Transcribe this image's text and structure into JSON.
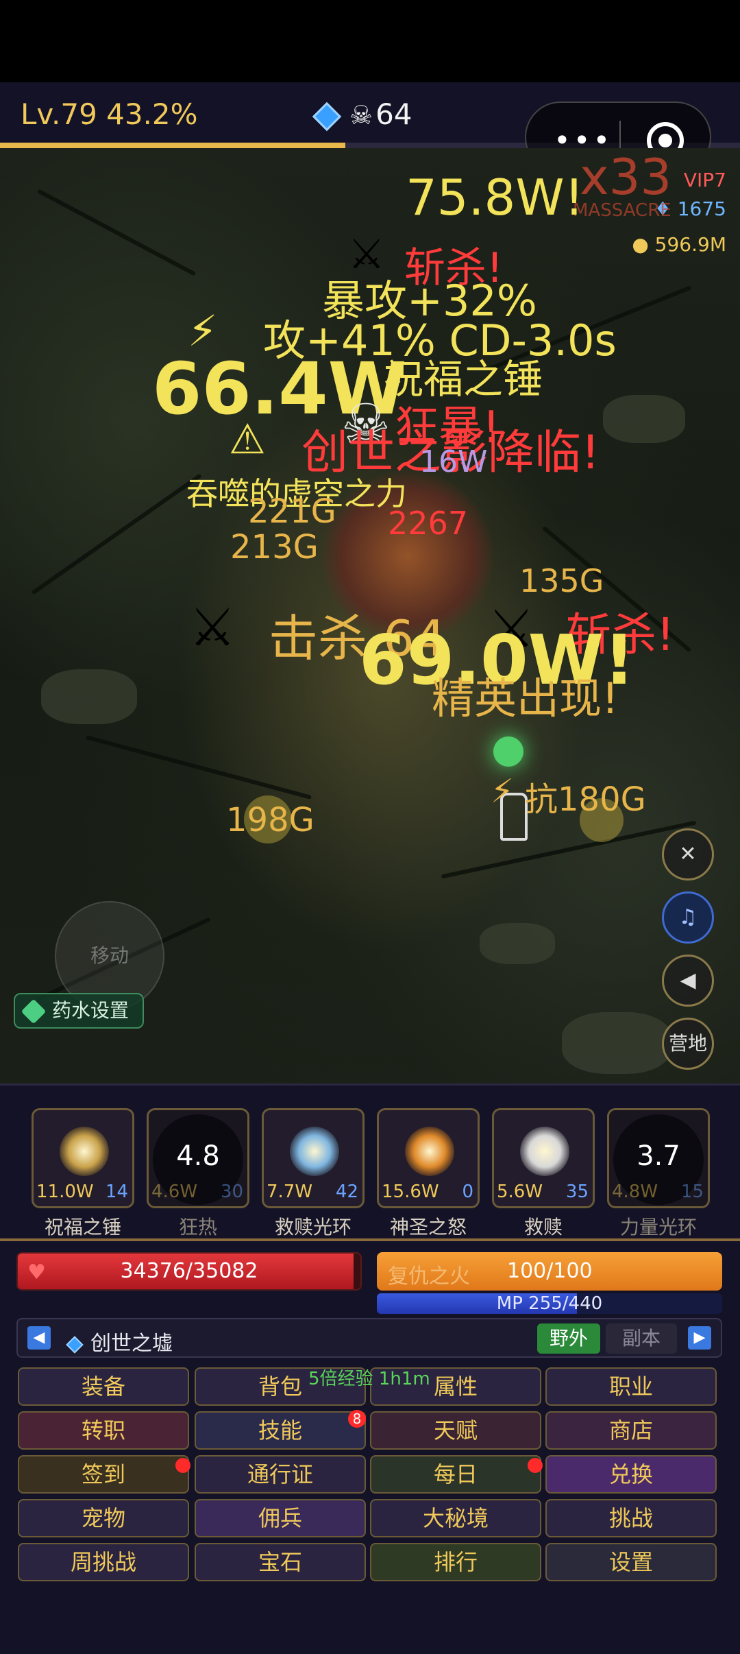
{
  "status": {
    "level": "Lv.79 43.2%",
    "xp_progress": 0.432,
    "kills": "64"
  },
  "field": {
    "vip": "VIP7",
    "diamonds": "1675",
    "gold": "596.9M",
    "combo": "x33",
    "massacre": "MASSACRE",
    "floats": [
      {
        "id": "f1",
        "text": "75.8W!",
        "cls": "y"
      },
      {
        "id": "f2",
        "text": "斩杀!",
        "cls": "r"
      },
      {
        "id": "f3",
        "text": "暴攻+32%",
        "cls": "y"
      },
      {
        "id": "f4",
        "text": "攻+41% CD-3.0s",
        "cls": "y"
      },
      {
        "id": "f5",
        "text": "66.4W",
        "cls": "y"
      },
      {
        "id": "f6",
        "text": "祝福之锤",
        "cls": "y"
      },
      {
        "id": "f7",
        "text": "狂暴!",
        "cls": "r"
      },
      {
        "id": "f8",
        "text": "创世之影降临!",
        "cls": "r"
      },
      {
        "id": "f9",
        "text": "吞噬的虚空之力",
        "cls": "y"
      },
      {
        "id": "f10",
        "text": "221G",
        "cls": "o"
      },
      {
        "id": "f11",
        "text": "213G",
        "cls": "o"
      },
      {
        "id": "f12",
        "text": "2267",
        "cls": "r"
      },
      {
        "id": "f13",
        "text": "135G",
        "cls": "o"
      },
      {
        "id": "f14",
        "text": "击杀 64",
        "cls": "o"
      },
      {
        "id": "f15",
        "text": "斩杀!",
        "cls": "r"
      },
      {
        "id": "f16",
        "text": "69.0W!",
        "cls": "y"
      },
      {
        "id": "f17",
        "text": "精英出现!",
        "cls": "o"
      },
      {
        "id": "f18",
        "text": "抗180G",
        "cls": "o"
      },
      {
        "id": "f19",
        "text": "198G",
        "cls": "o"
      },
      {
        "id": "f20",
        "text": "16W",
        "cls": "r"
      }
    ],
    "joystick": "移动",
    "potion_settings": "药水设置",
    "camp": "营地"
  },
  "skills": [
    {
      "name": "祝福之锤",
      "dmg": "11.0W",
      "lv": "14",
      "cd": "",
      "color": "#c9a24a"
    },
    {
      "name": "狂热",
      "dmg": "4.6W",
      "lv": "30",
      "cd": "4.8",
      "color": "#9a2a2a"
    },
    {
      "name": "救赎光环",
      "dmg": "7.7W",
      "lv": "42",
      "cd": "",
      "color": "#7fb6e0"
    },
    {
      "name": "神圣之怒",
      "dmg": "15.6W",
      "lv": "0",
      "cd": "",
      "color": "#e08a2a"
    },
    {
      "name": "救赎",
      "dmg": "5.6W",
      "lv": "35",
      "cd": "",
      "color": "#d8d8d8"
    },
    {
      "name": "力量光环",
      "dmg": "4.8W",
      "lv": "15",
      "cd": "3.7",
      "color": "#a07a3a"
    }
  ],
  "bars": {
    "hp": "34376/35082",
    "hp_fraction": 0.98,
    "rage_label": "复仇之火",
    "rage": "100/100",
    "mp": "MP 255/440",
    "mp_fraction": 0.58
  },
  "map": {
    "name": "创世之墟",
    "tab_field": "野外",
    "tab_dungeon": "副本"
  },
  "promo": "5倍经验 1h1m",
  "menu": [
    {
      "label": "装备",
      "bg": "#2a2440"
    },
    {
      "label": "背包",
      "bg": "#2a2440"
    },
    {
      "label": "属性",
      "bg": "#2a2440"
    },
    {
      "label": "职业",
      "bg": "#2a2440"
    },
    {
      "label": "转职",
      "bg": "#4a2434"
    },
    {
      "label": "技能",
      "bg": "#2a2a4a"
    },
    {
      "label": "天赋",
      "bg": "#3a2434"
    },
    {
      "label": "商店",
      "bg": "#3a2440"
    },
    {
      "label": "签到",
      "bg": "#3a3020"
    },
    {
      "label": "通行证",
      "bg": "#2a2440"
    },
    {
      "label": "每日",
      "bg": "#2a3428"
    },
    {
      "label": "兑换",
      "bg": "#4a2a6a"
    },
    {
      "label": "宠物",
      "bg": "#2a2440"
    },
    {
      "label": "佣兵",
      "bg": "#3a2a5a"
    },
    {
      "label": "大秘境",
      "bg": "#2a2440"
    },
    {
      "label": "挑战",
      "bg": "#2a2440"
    },
    {
      "label": "周挑战",
      "bg": "#2a2440"
    },
    {
      "label": "宝石",
      "bg": "#2a2440"
    },
    {
      "label": "排行",
      "bg": "#2e3a24"
    },
    {
      "label": "设置",
      "bg": "#2a2a3a"
    }
  ],
  "skill_badge": "8"
}
